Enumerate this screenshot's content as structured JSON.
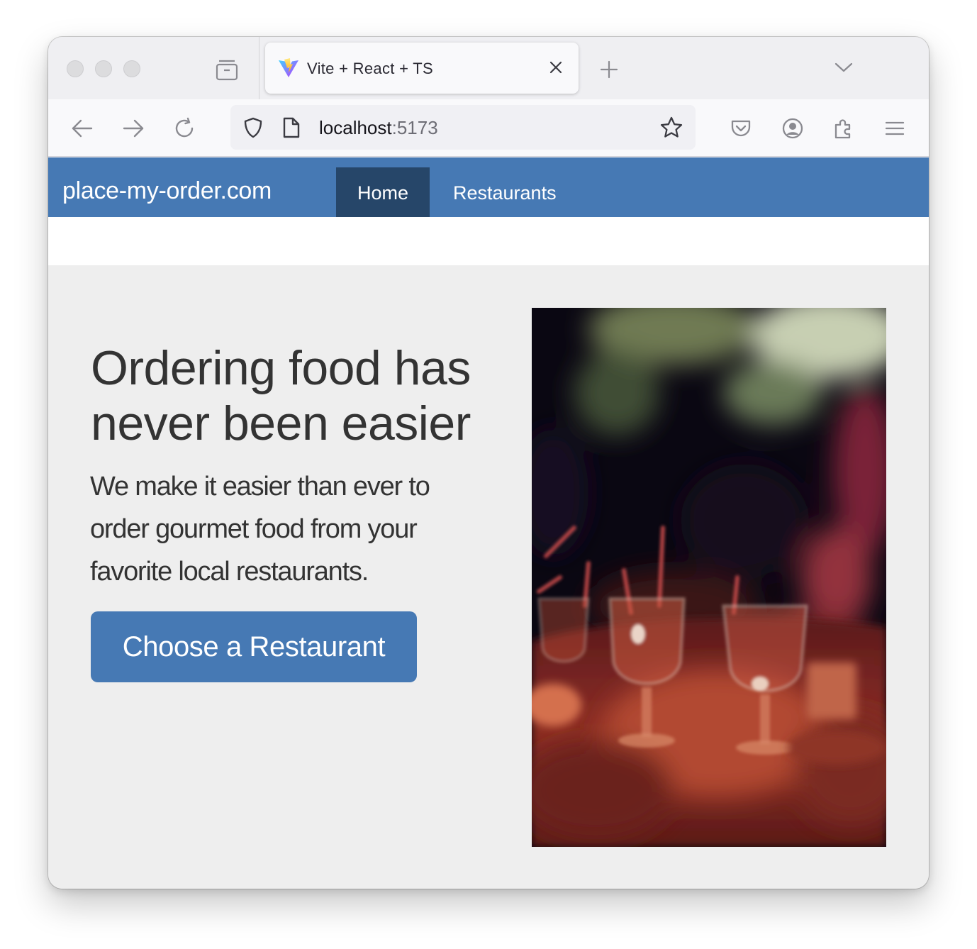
{
  "browser": {
    "tab_title": "Vite + React + TS",
    "url_host": "localhost",
    "url_port": ":5173"
  },
  "icons": {
    "tab_favicon": "vite-logo-icon",
    "tab_close": "close-icon",
    "new_tab": "plus-icon",
    "tab_list": "chevron-down-icon",
    "tab_overview": "tab-overview-icon",
    "back": "arrow-left-icon",
    "forward": "arrow-right-icon",
    "reload": "reload-icon",
    "shield": "shield-icon",
    "page": "page-icon",
    "bookmark": "star-icon",
    "pocket": "pocket-icon",
    "account": "account-icon",
    "extensions": "puzzle-icon",
    "menu": "hamburger-icon"
  },
  "site": {
    "brand": "place-my-order.com",
    "nav": {
      "home": "Home",
      "restaurants": "Restaurants"
    },
    "hero": {
      "title": "Ordering food has never been easier",
      "lead": "We make it easier than ever to order gourmet food from your favorite local restaurants.",
      "button": "Choose a Restaurant",
      "image_description": "blurred restaurant table with wine glasses in warm red light"
    }
  },
  "colors": {
    "site_nav": "#4679b4",
    "site_nav_active": "#264669",
    "page_background": "#eeeeee",
    "button": "#4679b4",
    "text": "#333333"
  }
}
